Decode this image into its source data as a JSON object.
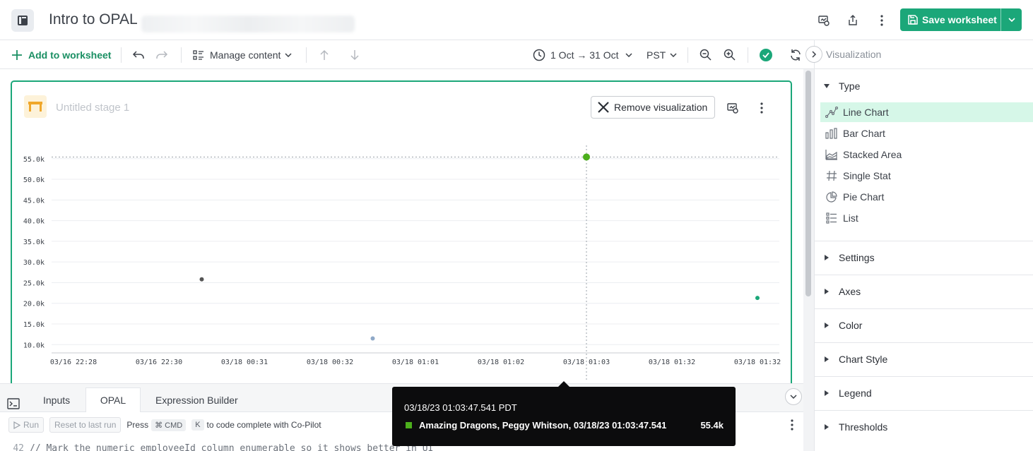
{
  "header": {
    "title": "Intro to OPAL",
    "save_label": "Save worksheet"
  },
  "toolbar": {
    "add_label": "Add to worksheet",
    "manage_label": "Manage content",
    "time_range": "1 Oct → 31 Oct",
    "timezone": "PST"
  },
  "viz_panel": {
    "title": "Visualization",
    "type_section": "Type",
    "types": [
      {
        "label": "Line Chart",
        "icon": "line-chart-icon",
        "active": true
      },
      {
        "label": "Bar Chart",
        "icon": "bar-chart-icon",
        "active": false
      },
      {
        "label": "Stacked Area",
        "icon": "stacked-area-icon",
        "active": false
      },
      {
        "label": "Single Stat",
        "icon": "hash-icon",
        "active": false
      },
      {
        "label": "Pie Chart",
        "icon": "pie-chart-icon",
        "active": false
      },
      {
        "label": "List",
        "icon": "list-icon",
        "active": false
      }
    ],
    "sections": [
      "Settings",
      "Axes",
      "Color",
      "Chart Style",
      "Legend",
      "Thresholds"
    ]
  },
  "stage": {
    "title": "Untitled stage 1",
    "remove_label": "Remove visualization"
  },
  "bottom": {
    "tabs": [
      "Inputs",
      "OPAL",
      "Expression Builder"
    ],
    "active_tab": "OPAL",
    "run_label": "Run",
    "reset_label": "Reset to last run",
    "hint_press": "Press",
    "hint_key1": "⌘ CMD",
    "hint_key2": "K",
    "hint_rest": "to code complete with Co-Pilot",
    "code_line_number": "42",
    "code_line_text": "// Mark the numeric employeeId column enumerable so it shows better in UI"
  },
  "tooltip": {
    "time": "03/18/23 01:03:47.541 PDT",
    "label": "Amazing Dragons, Peggy Whitson, 03/18/23 01:03:47.541",
    "value": "55.4k",
    "color": "#4caf1c"
  },
  "colors": {
    "accent": "#1ba779",
    "active_type_bg": "#d6f7e8"
  },
  "chart_data": {
    "type": "scatter",
    "x_ticks": [
      "03/16 22:28",
      "03/16 22:30",
      "03/18 00:31",
      "03/18 00:32",
      "03/18 01:01",
      "03/18 01:02",
      "03/18 01:03",
      "03/18 01:32",
      "03/18 01:32"
    ],
    "y_ticks": [
      "55.0k",
      "50.0k",
      "45.0k",
      "40.0k",
      "35.0k",
      "30.0k",
      "25.0k",
      "20.0k",
      "15.0k",
      "10.0k"
    ],
    "ylim": [
      8000,
      56500
    ],
    "grid": true,
    "hover": {
      "tick_index": 6,
      "y": 55400
    },
    "points": [
      {
        "tick_index": 1.5,
        "y": 25800,
        "color": "#555555"
      },
      {
        "tick_index": 3.5,
        "y": 11500,
        "color": "#8fa9c8"
      },
      {
        "tick_index": 6.0,
        "y": 55400,
        "color": "#4caf1c"
      },
      {
        "tick_index": 8.0,
        "y": 21300,
        "color": "#1ba779"
      }
    ]
  }
}
